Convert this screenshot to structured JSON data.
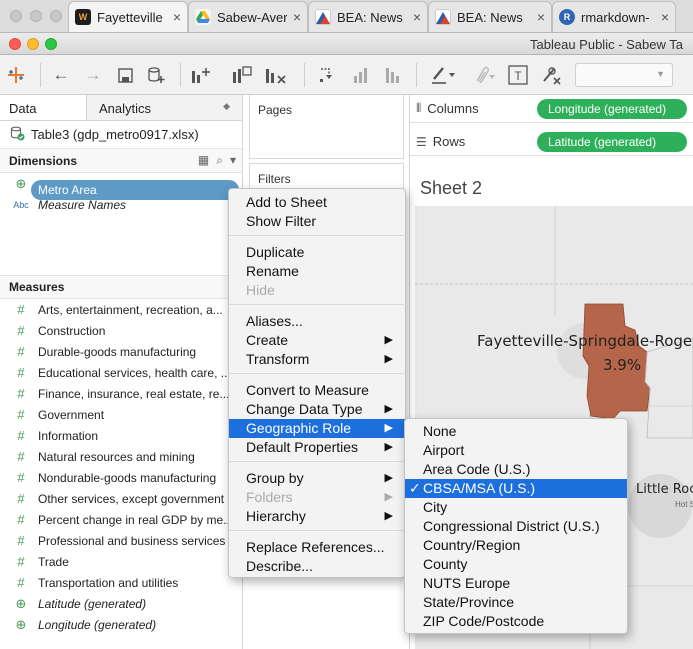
{
  "browser": {
    "tabs": [
      {
        "label": "Fayetteville",
        "icon": "fayetteville-favicon-icon",
        "color": "#1e1e1e"
      },
      {
        "label": "Sabew-Aver",
        "icon": "google-drive-icon",
        "color": "#2f9e44"
      },
      {
        "label": "BEA: News",
        "icon": "bea-favicon-icon",
        "color": "#2b5ea8"
      },
      {
        "label": "BEA: News",
        "icon": "bea-favicon-icon",
        "color": "#2b5ea8"
      },
      {
        "label": "rmarkdown-",
        "icon": "r-logo-icon",
        "color": "#2f66b3"
      }
    ]
  },
  "window": {
    "title": "Tableau Public - Sabew Ta"
  },
  "data_pane": {
    "tab_data": "Data",
    "tab_analytics": "Analytics",
    "datasource": "Table3 (gdp_metro0917.xlsx)",
    "dimensions_header": "Dimensions",
    "dimensions": [
      {
        "label": "Metro Area",
        "type": "geo"
      },
      {
        "label": "Measure Names",
        "type": "abc"
      }
    ],
    "measures_header": "Measures",
    "measures": [
      {
        "label": "Arts, entertainment, recreation, a...",
        "type": "num"
      },
      {
        "label": "Construction",
        "type": "num"
      },
      {
        "label": "Durable-goods manufacturing",
        "type": "num"
      },
      {
        "label": "Educational services, health care, ...",
        "type": "num"
      },
      {
        "label": "Finance, insurance, real estate, re...",
        "type": "num"
      },
      {
        "label": "Government",
        "type": "num"
      },
      {
        "label": "Information",
        "type": "num"
      },
      {
        "label": "Natural resources and mining",
        "type": "num"
      },
      {
        "label": "Nondurable-goods manufacturing",
        "type": "num"
      },
      {
        "label": "Other services, except government",
        "type": "num"
      },
      {
        "label": "Percent change in real GDP by me...",
        "type": "num"
      },
      {
        "label": "Professional and business services",
        "type": "num"
      },
      {
        "label": "Trade",
        "type": "num"
      },
      {
        "label": "Transportation and utilities",
        "type": "num"
      },
      {
        "label": "Latitude (generated)",
        "type": "geo"
      },
      {
        "label": "Longitude (generated)",
        "type": "geo"
      }
    ]
  },
  "shelves": {
    "pages": "Pages",
    "filters": "Filters",
    "columns_label": "Columns",
    "columns_pill": "Longitude (generated)",
    "rows_label": "Rows",
    "rows_pill": "Latitude (generated)"
  },
  "sheet": {
    "title": "Sheet 2",
    "map_label_main": "Fayetteville-Springdale-Roge",
    "map_label_value": "3.9%",
    "map_label_secondary": "Little Roc",
    "map_label_tiny": "Hot S",
    "highlight_color": "#b5664a"
  },
  "context_menu": {
    "items": [
      {
        "label": "Add to Sheet",
        "disabled": false,
        "submenu": false
      },
      {
        "label": "Show Filter",
        "disabled": false,
        "submenu": false
      },
      {
        "label": "Duplicate",
        "disabled": false,
        "submenu": false
      },
      {
        "label": "Rename",
        "disabled": false,
        "submenu": false
      },
      {
        "label": "Hide",
        "disabled": true,
        "submenu": false
      },
      {
        "label": "Aliases...",
        "disabled": false,
        "submenu": false
      },
      {
        "label": "Create",
        "disabled": false,
        "submenu": true
      },
      {
        "label": "Transform",
        "disabled": false,
        "submenu": true
      },
      {
        "label": "Convert to Measure",
        "disabled": false,
        "submenu": false
      },
      {
        "label": "Change Data Type",
        "disabled": false,
        "submenu": true
      },
      {
        "label": "Geographic Role",
        "disabled": false,
        "submenu": true,
        "highlighted": true
      },
      {
        "label": "Default Properties",
        "disabled": false,
        "submenu": true
      },
      {
        "label": "Group by",
        "disabled": false,
        "submenu": true
      },
      {
        "label": "Folders",
        "disabled": true,
        "submenu": true
      },
      {
        "label": "Hierarchy",
        "disabled": false,
        "submenu": true
      },
      {
        "label": "Replace References...",
        "disabled": false,
        "submenu": false
      },
      {
        "label": "Describe...",
        "disabled": false,
        "submenu": false
      }
    ]
  },
  "geo_submenu": {
    "items": [
      {
        "label": "None",
        "checked": false
      },
      {
        "label": "Airport",
        "checked": false
      },
      {
        "label": "Area Code (U.S.)",
        "checked": false
      },
      {
        "label": "CBSA/MSA (U.S.)",
        "checked": true
      },
      {
        "label": "City",
        "checked": false
      },
      {
        "label": "Congressional District (U.S.)",
        "checked": false
      },
      {
        "label": "Country/Region",
        "checked": false
      },
      {
        "label": "County",
        "checked": false
      },
      {
        "label": "NUTS Europe",
        "checked": false
      },
      {
        "label": "State/Province",
        "checked": false
      },
      {
        "label": "ZIP Code/Postcode",
        "checked": false
      }
    ]
  }
}
